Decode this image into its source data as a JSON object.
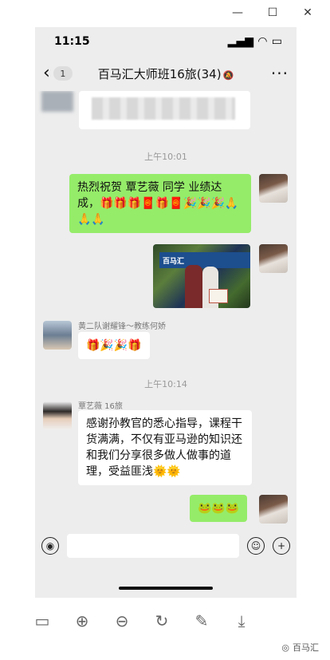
{
  "window": {
    "controls": [
      "minimize-icon",
      "maximize-icon",
      "close-icon"
    ]
  },
  "status": {
    "time": "11:15"
  },
  "header": {
    "back_count": "1",
    "title": "百马汇大师班16旅(34)"
  },
  "times": {
    "t1": "上午10:01",
    "t2": "上午10:14"
  },
  "messages": {
    "m1": "热烈祝贺 覃艺薇 同学 业绩达成，🎁🎁🎁🧧🎁🧧🎉🎉🎉🙏🙏🙏",
    "m2_banner": "百马汇",
    "m3_sender": "黄二队谢耀锋～教练何娇",
    "m3_text": "🎁🎉🎉🎁",
    "m4_sender": "覃艺薇 16旅",
    "m4_text": "感谢孙教官的悉心指导，课程干货满满，不仅有亚马逊的知识还和我们分享很多做人做事的道理，受益匪浅🌞🌞",
    "m5_text": "🐸🐸🐸"
  },
  "footer": {
    "brand": "百马汇"
  },
  "colors": {
    "green_bubble": "#95ec69",
    "chat_bg": "#ededed"
  }
}
